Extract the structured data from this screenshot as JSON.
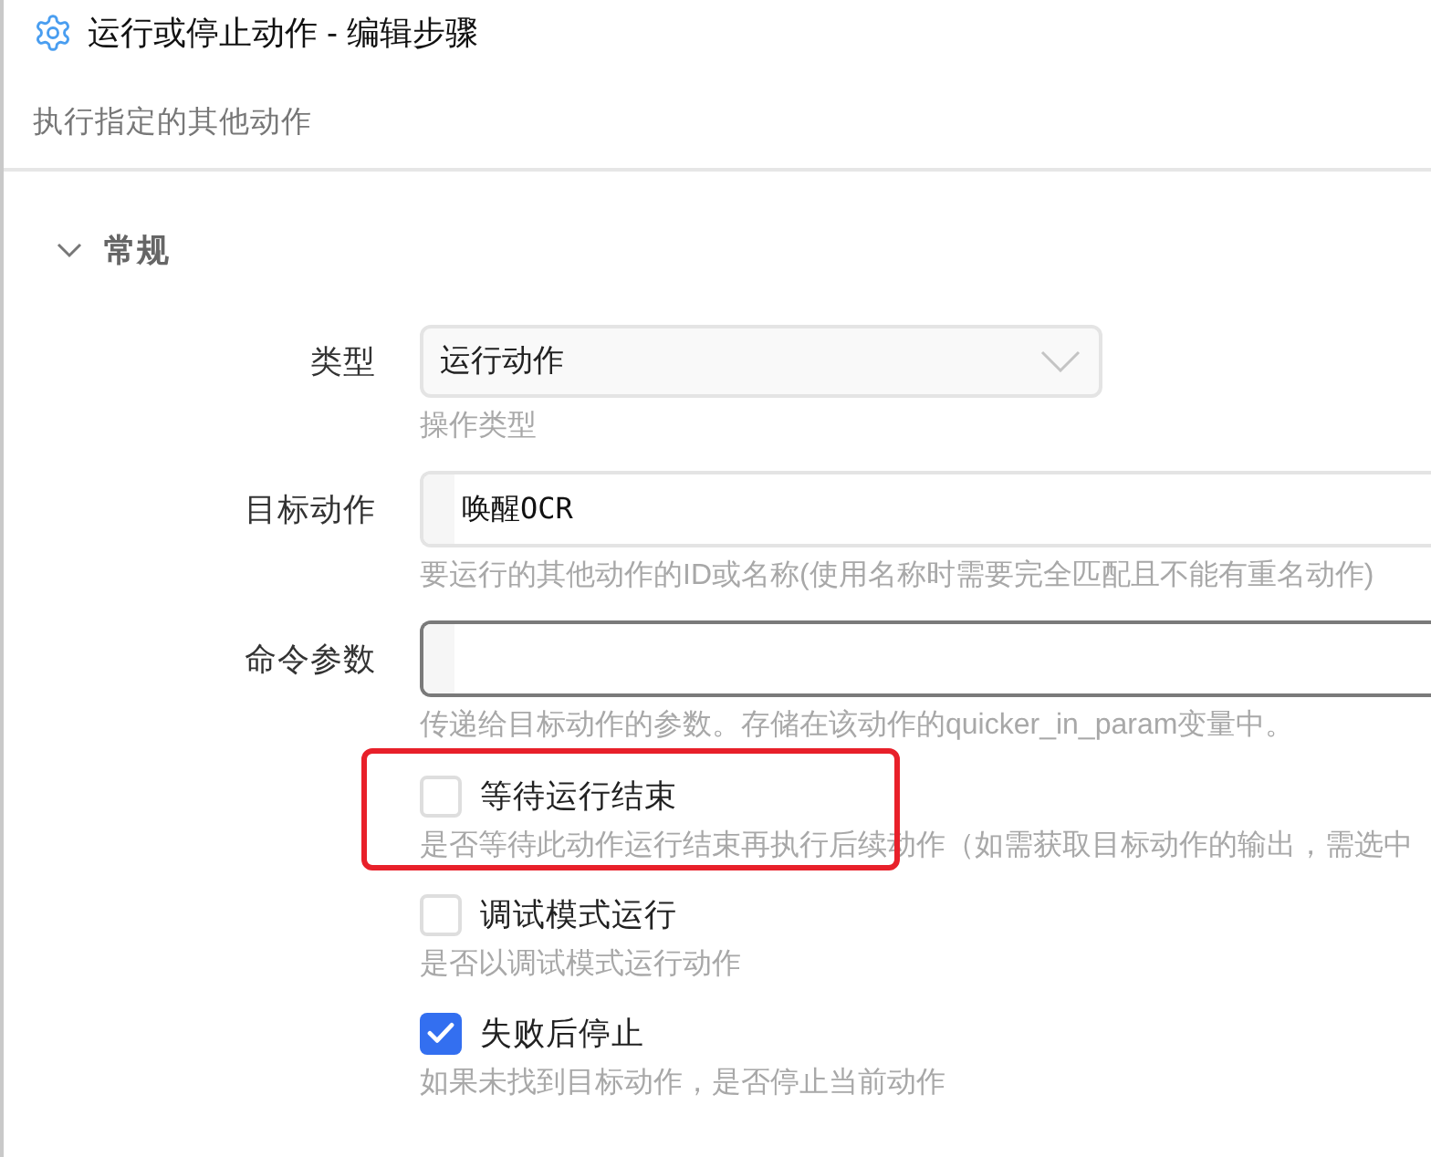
{
  "window": {
    "title": "运行或停止动作 - 编辑步骤",
    "subtitle": "执行指定的其他动作"
  },
  "section": {
    "title": "常规",
    "expanded": true
  },
  "fields": [
    {
      "kind": "select",
      "label": "类型",
      "value": "运行动作",
      "hint": "操作类型",
      "focused": false
    },
    {
      "kind": "text",
      "label": "目标动作",
      "value": "唤醒OCR",
      "hint": "要运行的其他动作的ID或名称(使用名称时需要完全匹配且不能有重名动作)",
      "focused": false
    },
    {
      "kind": "text",
      "label": "命令参数",
      "hint": "传递给目标动作的参数。存储在该动作的quicker_in_param变量中。",
      "focused": true
    }
  ],
  "options": [
    {
      "label": "等待运行结束",
      "hint": "是否等待此动作运行结束再执行后续动作（如需获取目标动作的输出，需选中",
      "checked": false,
      "highlighted": true
    },
    {
      "label": "调试模式运行",
      "hint": "是否以调试模式运行动作",
      "checked": false,
      "highlighted": false
    },
    {
      "label": "失败后停止",
      "hint": "如果未找到目标动作，是否停止当前动作",
      "checked": true,
      "highlighted": false
    }
  ]
}
